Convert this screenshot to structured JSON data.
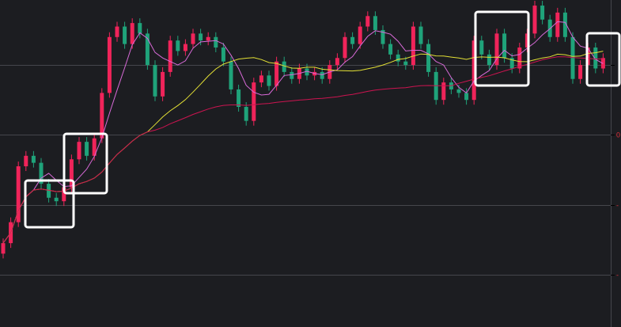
{
  "chart_data": {
    "type": "candlestick",
    "title": "",
    "y_tick_labels": [
      {
        "value": 3,
        "label": ""
      },
      {
        "value": 2,
        "label": "0"
      },
      {
        "value": 1,
        "label": "-"
      },
      {
        "value": 0,
        "label": "-"
      }
    ],
    "ylim": [
      -0.75,
      3.93
    ],
    "grid": true,
    "up_color": "#f0245a",
    "down_color": "#1fa37a",
    "open": [
      0.3,
      0.45,
      0.75,
      1.55,
      1.7,
      1.6,
      1.3,
      1.1,
      1.05,
      1.25,
      1.65,
      1.9,
      1.7,
      1.95,
      2.6,
      3.4,
      3.55,
      3.3,
      3.6,
      3.45,
      3.0,
      2.55,
      2.9,
      3.35,
      3.2,
      3.3,
      3.45,
      3.35,
      3.4,
      3.25,
      3.05,
      2.65,
      2.4,
      2.2,
      2.75,
      2.85,
      2.7,
      3.05,
      2.9,
      2.8,
      2.95,
      2.85,
      2.9,
      2.8,
      3.0,
      3.1,
      3.4,
      3.3,
      3.55,
      3.7,
      3.5,
      3.3,
      3.15,
      3.05,
      3.0,
      3.55,
      3.3,
      2.9,
      2.5,
      2.75,
      2.65,
      2.6,
      2.5,
      3.35,
      3.15,
      3.0,
      3.45,
      3.1,
      2.95,
      3.25,
      3.45,
      3.85,
      3.65,
      3.4,
      3.75,
      3.4,
      2.8,
      3.0,
      3.25,
      2.95
    ],
    "close": [
      0.45,
      0.75,
      1.55,
      1.7,
      1.6,
      1.3,
      1.1,
      1.05,
      1.25,
      1.65,
      1.9,
      1.7,
      1.95,
      2.6,
      3.4,
      3.55,
      3.3,
      3.6,
      3.45,
      3.0,
      2.55,
      2.9,
      3.35,
      3.2,
      3.3,
      3.45,
      3.35,
      3.4,
      3.25,
      3.05,
      2.65,
      2.4,
      2.2,
      2.75,
      2.85,
      2.7,
      3.05,
      2.9,
      2.8,
      2.95,
      2.85,
      2.9,
      2.8,
      3.0,
      3.1,
      3.4,
      3.3,
      3.55,
      3.7,
      3.5,
      3.3,
      3.15,
      3.05,
      3.0,
      3.55,
      3.3,
      2.9,
      2.5,
      2.75,
      2.65,
      2.6,
      2.5,
      3.35,
      3.15,
      3.0,
      3.45,
      3.1,
      2.95,
      3.25,
      3.45,
      3.85,
      3.65,
      3.4,
      3.75,
      3.4,
      2.8,
      3.0,
      3.25,
      2.95,
      3.1
    ],
    "moving_averages": [
      {
        "name": "MA5",
        "period": 5,
        "color": "#d86ad8"
      },
      {
        "name": "MA20",
        "period": 20,
        "color": "#e3e035"
      },
      {
        "name": "MA60",
        "period": 60,
        "color": "#cc1450"
      }
    ]
  }
}
